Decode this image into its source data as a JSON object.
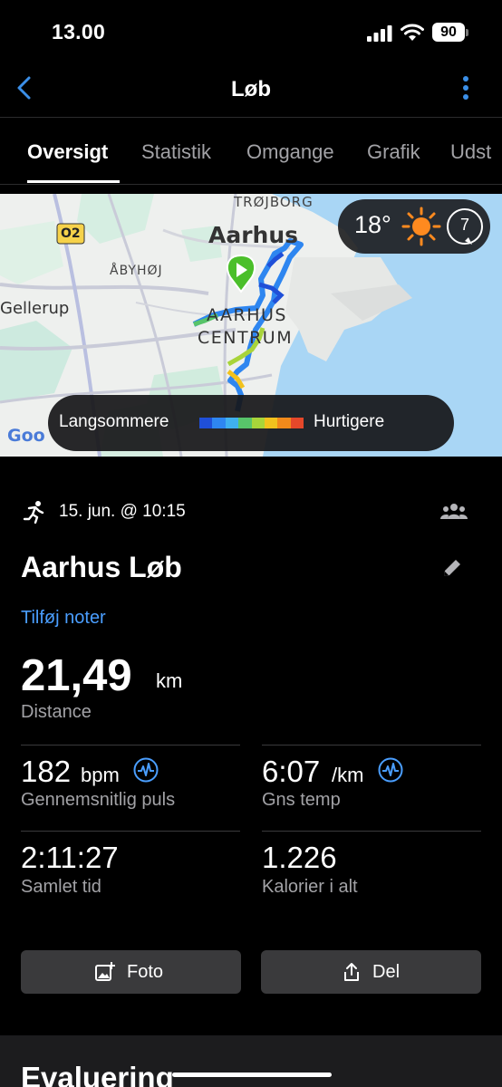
{
  "status_bar": {
    "time": "13.00",
    "battery": "90"
  },
  "nav": {
    "title": "Løb",
    "back_icon": "chevron-left-icon",
    "more_icon": "vertical-dots-icon"
  },
  "tabs": [
    {
      "label": "Oversigt",
      "active": true
    },
    {
      "label": "Statistik",
      "active": false
    },
    {
      "label": "Omgange",
      "active": false
    },
    {
      "label": "Grafik",
      "active": false
    },
    {
      "label": "Udst",
      "active": false
    }
  ],
  "map": {
    "labels": {
      "trojborg": "TRØJBORG",
      "road": "O2",
      "aarhus": "Aarhus",
      "abyhoj": "ÅBYHØJ",
      "gellerup": "Gellerup",
      "centrum_1": "AARHUS",
      "centrum_2": "CENTRUM",
      "google": "Goo"
    },
    "weather": {
      "temperature": "18°",
      "wind": "7",
      "icon": "sun-icon"
    },
    "legend": {
      "slow_label": "Langsommere",
      "fast_label": "Hurtigere",
      "colors": [
        "#1f4fd8",
        "#2e86f0",
        "#3fb0ee",
        "#58c46a",
        "#a8d43a",
        "#f2c21d",
        "#f28a1b",
        "#e5482a"
      ]
    }
  },
  "activity": {
    "date": "15. jun. @ 10:15",
    "title": "Aarhus Løb",
    "add_notes": "Tilføj noter",
    "distance": {
      "value": "21,49",
      "unit": "km",
      "label": "Distance"
    },
    "stats": {
      "heart_rate": {
        "value": "182",
        "unit": "bpm",
        "label": "Gennemsnitlig puls"
      },
      "pace": {
        "value": "6:07",
        "unit": "/km",
        "label": "Gns temp"
      },
      "time": {
        "value": "2:11:27",
        "label": "Samlet tid"
      },
      "calories": {
        "value": "1.226",
        "label": "Kalorier i alt"
      }
    }
  },
  "actions": {
    "photo": "Foto",
    "share": "Del"
  },
  "evaluation": {
    "title": "Evaluering"
  },
  "colors": {
    "accent": "#4a9eff",
    "background": "#000000",
    "card": "#1c1c1e",
    "button": "#3a3a3c"
  }
}
